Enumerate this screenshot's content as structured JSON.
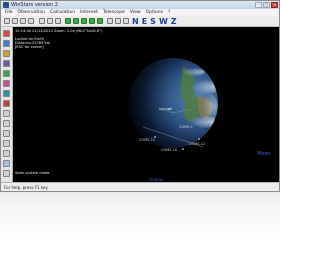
{
  "window": {
    "title": "WinStars version 2"
  },
  "menu": [
    "File",
    "Observation",
    "Calculation",
    "Internet",
    "Telescope",
    "View",
    "Options",
    "?"
  ],
  "toolbar": {
    "compass": [
      "N",
      "E",
      "S",
      "W",
      "Z"
    ]
  },
  "sky": {
    "info_lines": [
      "15:14:44  01/14/2012  Zoom: 1.0e (MLG°tdvD-R°)",
      "Locked on:Earth",
      "Distance:25769 km",
      "[ESC for cancel]"
    ],
    "planet_label": "Earth",
    "moon_label": "Moon",
    "bottom_label": "Uranus",
    "satellite_labels": [
      "COMS-1",
      "COMS-11",
      "COMS-12",
      "COMS-10"
    ],
    "orbit_label": "epitaxB",
    "mode_text": "Solar system mode"
  },
  "status": {
    "text": "For help, press F1 key"
  },
  "colors": {
    "sky": "#000000",
    "earth_ocean": "#23406e",
    "planet_label": "#3b5fd4",
    "compass": "#1e3f9a"
  }
}
